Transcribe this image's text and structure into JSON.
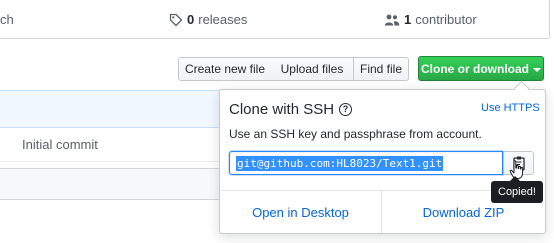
{
  "stats": {
    "branches_partial": "ch",
    "releases_count": "0",
    "releases_label": "releases",
    "contributors_count": "1",
    "contributors_label": "contributor"
  },
  "toolbar": {
    "create_new_file": "Create new file",
    "upload_files": "Upload files",
    "find_file": "Find file",
    "clone_or_download": "Clone or download"
  },
  "file_list": {
    "commit_message": "Initial commit"
  },
  "clone_panel": {
    "title": "Clone with SSH",
    "use_https": "Use HTTPS",
    "description": "Use an SSH key and passphrase from account.",
    "url": "git@github.com:HL8023/Text1.git",
    "tooltip": "Copied!",
    "open_in_desktop": "Open in Desktop",
    "download_zip": "Download ZIP"
  },
  "colors": {
    "accent_green": "#28a745",
    "link_blue": "#0366d6",
    "selection_blue": "#3390ff"
  },
  "icons": {
    "releases": "tag-icon",
    "contributors": "people-icon",
    "help": "question-icon",
    "copy": "clipboard-icon",
    "cursor": "hand-pointer-icon",
    "dropdown": "caret-down-icon"
  }
}
